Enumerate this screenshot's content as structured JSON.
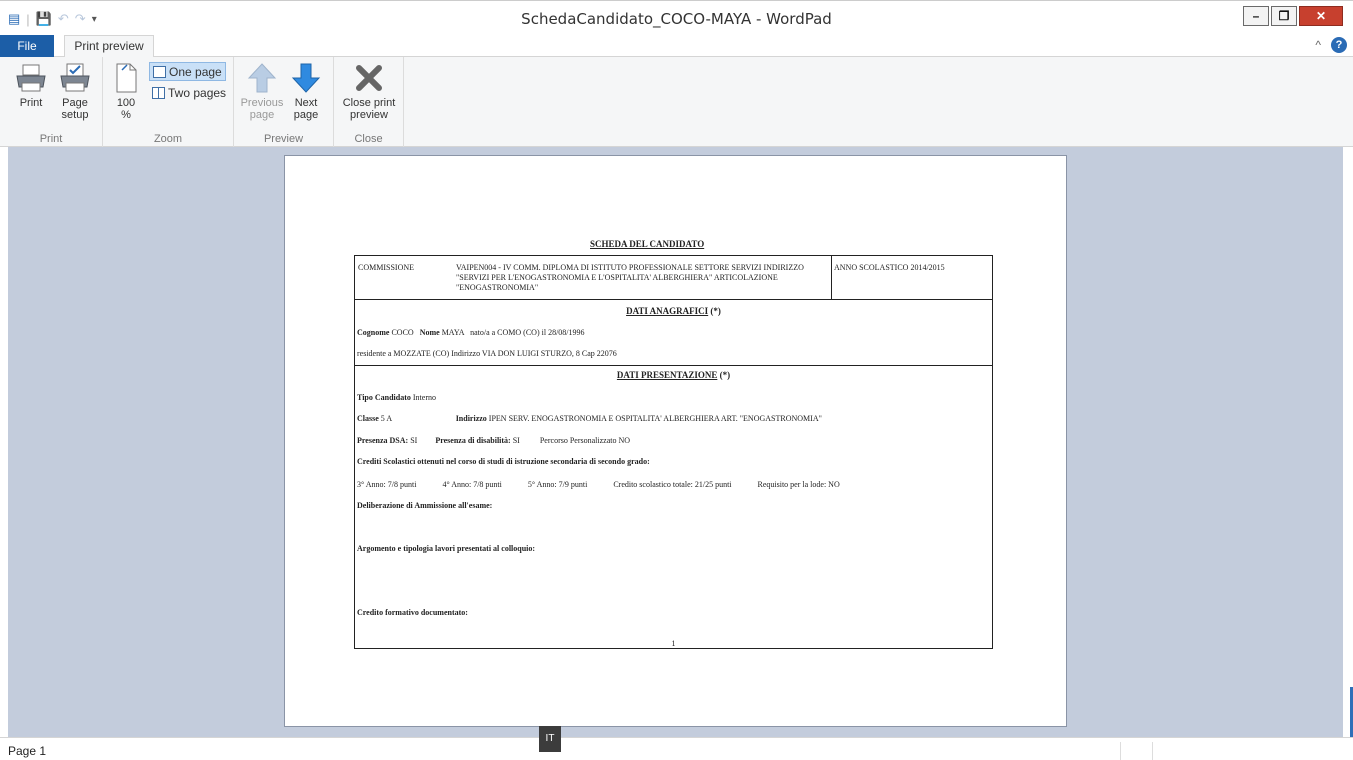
{
  "window": {
    "title": "SchedaCandidato_COCO-MAYA - WordPad",
    "controls": {
      "minimize": "–",
      "maximize": "❐",
      "close": "✕"
    }
  },
  "quick_access": {
    "save": "💾",
    "undo": "↶",
    "redo": "↷",
    "more": "▾"
  },
  "tabs": {
    "file": "File",
    "print_preview": "Print preview",
    "collapse": "^",
    "help": "?"
  },
  "ribbon": {
    "print_group": {
      "label": "Print",
      "print": "Print",
      "page_setup_1": "Page",
      "page_setup_2": "setup"
    },
    "zoom_group": {
      "label": "Zoom",
      "zoom_1": "100",
      "zoom_2": "%",
      "one_page": "One page",
      "two_pages": "Two pages"
    },
    "preview_group": {
      "label": "Preview",
      "prev_1": "Previous",
      "prev_2": "page",
      "next_1": "Next",
      "next_2": "page"
    },
    "close_group": {
      "label": "Close",
      "close_1": "Close print",
      "close_2": "preview"
    }
  },
  "document": {
    "title": "SCHEDA DEL CANDIDATO",
    "commissione_label": "COMMISSIONE",
    "commissione_text": "VAIPEN004 - IV COMM. DIPLOMA DI ISTITUTO PROFESSIONALE SETTORE SERVIZI INDIRIZZO \"SERVIZI PER L'ENOGASTRONOMIA E L'OSPITALITA' ALBERGHIERA\" ARTICOLAZIONE \"ENOGASTRONOMIA\"",
    "anno": "ANNO SCOLASTICO  2014/2015",
    "anagrafici_header": "DATI ANAGRAFICI",
    "asterisk": "(*)",
    "cognome_label": "Cognome",
    "cognome": "COCO",
    "nome_label": "Nome",
    "nome": "MAYA",
    "nato": "nato/a  a  COMO  (CO)   il  28/08/1996",
    "residente": "residente a  MOZZATE  (CO)    Indirizzo  VIA DON LUIGI STURZO, 8     Cap  22076",
    "presentazione_header": "DATI PRESENTAZIONE",
    "tipo_label": "Tipo Candidato",
    "tipo": "Interno",
    "classe_label": "Classe",
    "classe": "5 A",
    "indirizzo_label": "Indirizzo",
    "indirizzo": "IPEN SERV. ENOGASTRONOMIA E OSPITALITA' ALBERGHIERA ART. \"ENOGASTRONOMIA\"",
    "dsa_label": "Presenza DSA:",
    "dsa": "SI",
    "disabilita_label": "Presenza di disabilità:",
    "disabilita": "SI",
    "percorso": "Percorso Personalizzato NO",
    "crediti_heading": "Crediti Scolastici ottenuti nel corso di studi di istruzione secondaria di secondo grado:",
    "anno3": "3° Anno:  7/8  punti",
    "anno4": "4° Anno:  7/8  punti",
    "anno5": "5° Anno:  7/9  punti",
    "credito_totale": "Credito scolastico totale:  21/25  punti",
    "lode": "Requisito per la lode:  NO",
    "delibera": "Deliberazione di Ammissione all'esame:",
    "argomento": "Argomento e tipologia lavori presentati al colloquio:",
    "credito_formativo": "Credito formativo documentato:",
    "page_number": "1"
  },
  "status": {
    "page": "Page 1",
    "lang": "IT"
  }
}
